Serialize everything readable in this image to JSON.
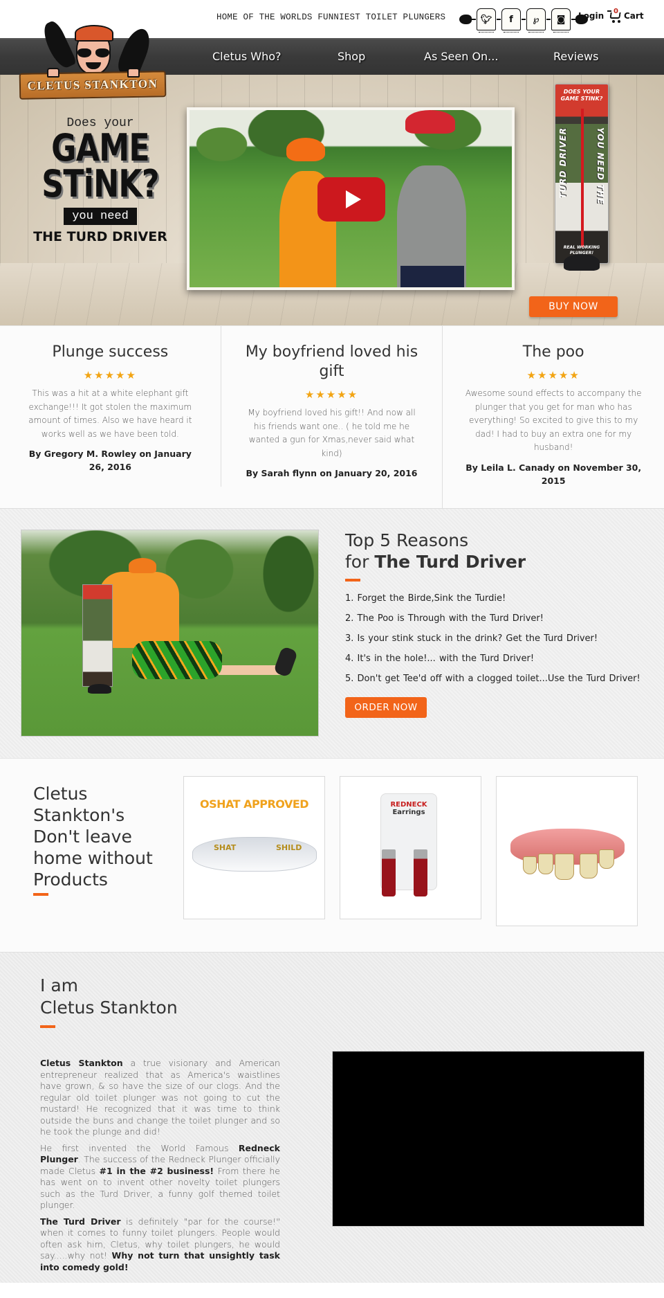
{
  "header": {
    "tagline": "HOME OF THE WORLDS FUNNIEST TOILET PLUNGERS",
    "social": [
      {
        "name": "twitter-icon",
        "glyph": "🐦︎"
      },
      {
        "name": "facebook-icon",
        "glyph": "f"
      },
      {
        "name": "pinterest-icon",
        "glyph": "℘"
      },
      {
        "name": "instagram-icon",
        "glyph": "◙"
      }
    ],
    "login_label": "Login",
    "cart_label": "Cart",
    "cart_count": "0"
  },
  "logo": {
    "text": "CLETUS STANKTON"
  },
  "nav": {
    "items": [
      {
        "label": "Cletus Who?"
      },
      {
        "label": "Shop"
      },
      {
        "label": "As Seen On..."
      },
      {
        "label": "Reviews"
      }
    ]
  },
  "hero": {
    "does_your": "Does your",
    "game": "GAME",
    "stink": "STiNK?",
    "you_need": "you need",
    "product_name": "THE TURD DRIVER",
    "box_top": "DOES YOUR GAME STINK?",
    "box_side_left": "TURD DRIVER",
    "box_side_right": "YOU NEED THE",
    "box_bottom": "REAL WORKING PLUNGER!",
    "buy_now_label": "BUY NOW"
  },
  "reviews": [
    {
      "title": "Plunge success",
      "rating": 5,
      "stars": "★★★★★",
      "body": "This was a hit at a white elephant gift exchange!!! It got stolen the maximum amount of times. Also we have heard it works well as we have been told.",
      "byline": "By Gregory M. Rowley on January 26, 2016"
    },
    {
      "title": "My boyfriend loved his gift",
      "rating": 5,
      "stars": "★★★★★",
      "body": "My boyfriend loved his gift!! And now all his friends want one.. ( he told me he wanted a gun for Xmas,never said what kind)",
      "byline": "By Sarah flynn on January 20, 2016"
    },
    {
      "title": "The poo",
      "rating": 5,
      "stars": "★★★★★",
      "body": "Awesome sound effects to accompany the plunger that you get for man who has everything! So excited to give this to my dad! I had to buy an extra one for my husband!",
      "byline": "By Leila L. Canady on November 30, 2015"
    }
  ],
  "reasons": {
    "title_line1": "Top 5 Reasons",
    "title_for": "for ",
    "title_bold": "The Turd Driver",
    "items": [
      "1. Forget the Birde,Sink the Turdie!",
      "2. The Poo is Through with the Turd Driver!",
      "3. Is your stink stuck in the drink? Get the Turd Driver!",
      "4. It's in the hole!... with the Turd Driver!",
      "5. Don't get Tee'd off with a clogged toilet...Use the Turd Driver!"
    ],
    "order_now_label": "ORDER NOW"
  },
  "products": {
    "heading": "Cletus Stankton's Don't leave home without Products",
    "items": [
      {
        "name": "OSHAT APPROVED Shat Shield glasses",
        "caption": "OSHAT APPROVED",
        "lens_left": "SHAT",
        "lens_right": "SHILD"
      },
      {
        "name": "Redneck Earrings",
        "caption_red": "REDNECK",
        "caption": "Earrings"
      },
      {
        "name": "Redneck teeth",
        "caption": ""
      }
    ]
  },
  "about": {
    "title_line1": "I am",
    "title_line2": "Cletus Stankton",
    "p1_bold": "Cletus Stankton",
    "p1": " a true visionary and American entrepreneur realized that as America's waistlines have grown, & so have the size of our clogs. And the regular old toilet plunger was not going to cut the mustard! He recognized that it was time to think outside the buns and change the toilet plunger and so he took the plunge and did!",
    "p2_a": "He first invented the World Famous ",
    "p2_bold1": "Redneck Plunger",
    "p2_b": ". The success of the Redneck Plunger officially made Cletus ",
    "p2_bold2": "#1 in the #2 business!",
    "p2_c": " From there he has went on to invent other novelty toilet plungers such as the Turd Driver, a funny golf themed toilet plunger.",
    "p3_bold1": "The Turd Driver",
    "p3": " is definitely \"par for the course!\" when it comes to funny toilet plungers. People would often ask him, Cletus, why toilet plungers, he would say.....why not! ",
    "p3_bold2": "Why not turn that unsightly task into comedy gold!"
  },
  "colors": {
    "accent": "#f26419",
    "nav_bg": "#3a3a3a",
    "star": "#f2a413",
    "play_red": "#cc181e"
  }
}
